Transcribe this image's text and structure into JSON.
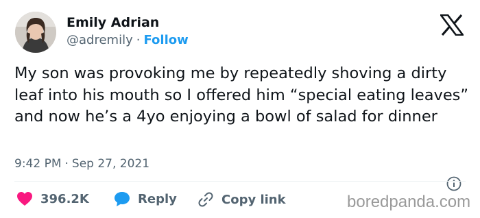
{
  "author": {
    "name": "Emily Adrian",
    "handle": "@adremily",
    "separator": "·",
    "follow_label": "Follow",
    "avatar_icon": "profile-photo"
  },
  "brand_icon": "x-logo",
  "tweet": {
    "text": "My son was provoking me by repeatedly shoving a dirty leaf into his mouth so I offered him “special eating leaves” and now he’s a 4yo enjoying a bowl of salad for dinner",
    "time": "9:42 PM",
    "separator": "·",
    "date": "Sep 27, 2021",
    "info_icon": "info-icon"
  },
  "actions": {
    "likes_count": "396.2K",
    "reply_label": "Reply",
    "copy_link_label": "Copy link"
  },
  "colors": {
    "accent": "#1d9bf0",
    "like": "#f91880",
    "text": "#0f1419",
    "secondary": "#536471"
  },
  "watermark": "boredpanda.com"
}
